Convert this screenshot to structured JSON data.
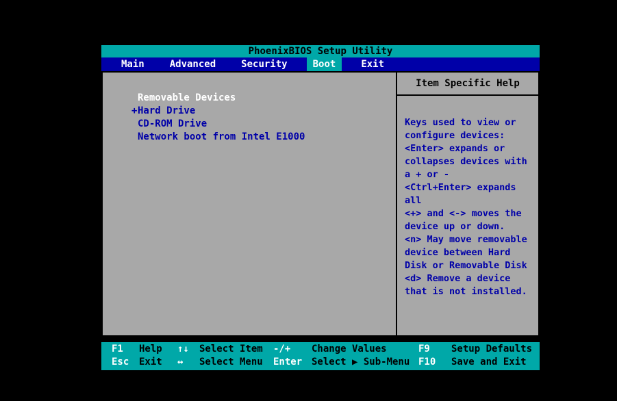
{
  "title_bar": {
    "title": "PhoenixBIOS Setup Utility"
  },
  "menu": {
    "active_tab": "Boot",
    "tabs": [
      {
        "label": "Main"
      },
      {
        "label": "Advanced"
      },
      {
        "label": "Security"
      },
      {
        "label": "Boot"
      },
      {
        "label": "Exit"
      }
    ]
  },
  "boot_list": {
    "items": [
      {
        "prefix": "",
        "label": "Removable Devices",
        "selected": true
      },
      {
        "prefix": "+",
        "label": "Hard Drive",
        "selected": false
      },
      {
        "prefix": "",
        "label": "CD-ROM Drive",
        "selected": false
      },
      {
        "prefix": "",
        "label": "Network boot from Intel E1000",
        "selected": false
      }
    ]
  },
  "help": {
    "title": "Item Specific Help",
    "body": "Keys used to view or\nconfigure devices:\n<Enter> expands or\ncollapses devices with\na + or -\n<Ctrl+Enter> expands\nall\n<+> and <-> moves the\ndevice up or down.\n<n> May move removable\ndevice between Hard\nDisk or Removable Disk\n<d> Remove a device\nthat is not installed."
  },
  "footer": {
    "rows": [
      [
        {
          "key": "F1",
          "label": "Help"
        },
        {
          "key": "↑↓",
          "label": "Select Item"
        },
        {
          "key": "-/+",
          "label": "Change Values"
        },
        {
          "key": "F9",
          "label": "Setup Defaults"
        }
      ],
      [
        {
          "key": "Esc",
          "label": "Exit"
        },
        {
          "key": "↔",
          "label": "Select Menu"
        },
        {
          "key": "Enter",
          "label": "Select ▶ Sub-Menu"
        },
        {
          "key": "F10",
          "label": "Save and Exit"
        }
      ]
    ]
  },
  "colors": {
    "teal": "#00a8a8",
    "navy_bar": "#0000a8",
    "body_gray": "#a8a8a8",
    "text_blue": "#0000a8",
    "text_white": "#ffffff",
    "text_black": "#000000"
  }
}
